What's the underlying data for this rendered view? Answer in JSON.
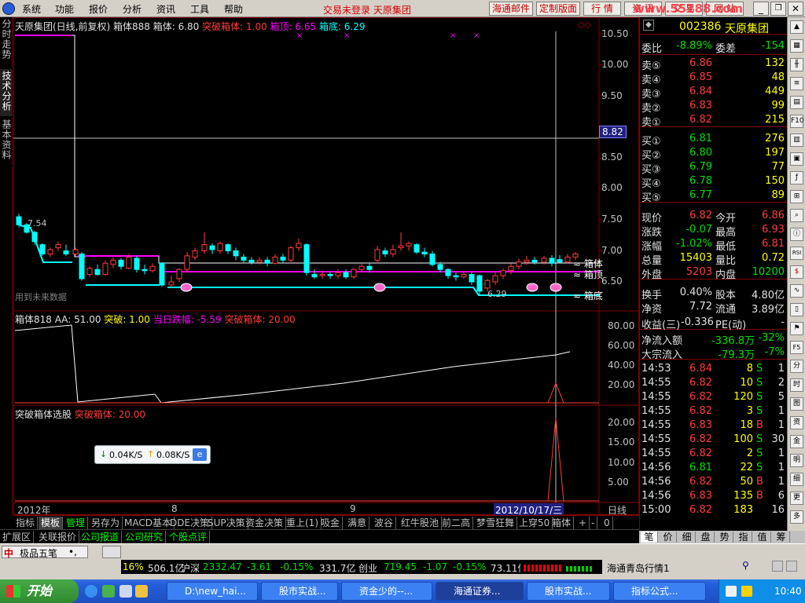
{
  "menubar": {
    "items": [
      "系统",
      "功能",
      "报价",
      "分析",
      "资讯",
      "工具",
      "帮助"
    ],
    "notice": "交易未登录  天原集团",
    "buttons": [
      "海通邮件",
      "定制版面",
      "行 情",
      "资 讯",
      "交 易",
      "网 站"
    ],
    "watermark": "www.55188.com"
  },
  "left_tabs": [
    "分时走势",
    "技术分析",
    "基本资料"
  ],
  "main_chart": {
    "title_left": "天原集团(日线,前复权) 箱体888",
    "box": "箱体: 6.80",
    "breakout": "突破箱体: 1.00",
    "top": "箱顶: 6.65",
    "bottom": "箱底: 6.29",
    "y_ticks": [
      "10.50",
      "10.00",
      "9.50",
      "8.82",
      "8.50",
      "8.00",
      "7.50",
      "7.00",
      "6.50"
    ],
    "hi_label": "7.54",
    "lo_label": "6.29",
    "future_note": "用到未来数据",
    "right_labels": [
      "箱体",
      "箱顶",
      "箱底"
    ],
    "cursor_price": "8.82"
  },
  "sub1": {
    "title": "箱体818",
    "aa": "AA: 51.00",
    "tupo": "突破: 1.00",
    "drop": "当日跌幅: -5.59",
    "breakout": "突破箱体: 20.00",
    "y_ticks": [
      "80.00",
      "60.00",
      "40.00",
      "20.00"
    ]
  },
  "sub2": {
    "title": "突破箱体选股",
    "breakout": "突破箱体: 20.00",
    "y_ticks": [
      "20.00",
      "15.00",
      "10.00",
      "5.00"
    ]
  },
  "x_axis": {
    "year": "2012年",
    "m8": "8",
    "m9": "9",
    "cursor_date": "2012/10/17/三",
    "period": "日线"
  },
  "netwidget": {
    "down": "0.04K/S",
    "up": "0.08K/S"
  },
  "quote": {
    "code": "002386",
    "name": "天原集团",
    "weibi_label": "委比",
    "weibi": "-8.89%",
    "weicha_label": "委差",
    "weicha": "-154",
    "asks": [
      {
        "label": "卖⑤",
        "price": "6.86",
        "vol": "132"
      },
      {
        "label": "卖④",
        "price": "6.85",
        "vol": "48"
      },
      {
        "label": "卖③",
        "price": "6.84",
        "vol": "449"
      },
      {
        "label": "卖②",
        "price": "6.83",
        "vol": "99"
      },
      {
        "label": "卖①",
        "price": "6.82",
        "vol": "215"
      }
    ],
    "bids": [
      {
        "label": "买①",
        "price": "6.81",
        "vol": "276"
      },
      {
        "label": "买②",
        "price": "6.80",
        "vol": "197"
      },
      {
        "label": "买③",
        "price": "6.79",
        "vol": "77"
      },
      {
        "label": "买④",
        "price": "6.78",
        "vol": "150"
      },
      {
        "label": "买⑤",
        "price": "6.77",
        "vol": "89"
      }
    ],
    "stats": [
      {
        "l1": "现价",
        "v1": "6.82",
        "c1": "red",
        "l2": "今开",
        "v2": "6.86",
        "c2": "red"
      },
      {
        "l1": "涨跌",
        "v1": "-0.07",
        "c1": "grn",
        "l2": "最高",
        "v2": "6.93",
        "c2": "red"
      },
      {
        "l1": "涨幅",
        "v1": "-1.02%",
        "c1": "grn",
        "l2": "最低",
        "v2": "6.81",
        "c2": "red"
      },
      {
        "l1": "总量",
        "v1": "15403",
        "c1": "yel",
        "l2": "量比",
        "v2": "0.72",
        "c2": "yel"
      },
      {
        "l1": "外盘",
        "v1": "5203",
        "c1": "red",
        "l2": "内盘",
        "v2": "10200",
        "c2": "grn"
      }
    ],
    "stats2": [
      {
        "l1": "换手",
        "v1": "0.40%",
        "l2": "股本",
        "v2": "4.80亿"
      },
      {
        "l1": "净资",
        "v1": "7.72",
        "l2": "流通",
        "v2": "3.89亿"
      }
    ],
    "pe": {
      "l1": "收益(三)",
      "v1": "-0.336",
      "l2": "PE(动)",
      "v2": "-"
    },
    "flow": [
      {
        "label": "净流入额",
        "value": "-336.8万",
        "pct": "-32%"
      },
      {
        "label": "大宗流入",
        "value": "-79.3万",
        "pct": "-7%"
      }
    ],
    "ticks": [
      {
        "t": "14:53",
        "p": "6.84",
        "v": "8",
        "s": "S",
        "n": "1",
        "pc": "red",
        "sc": "grn"
      },
      {
        "t": "14:55",
        "p": "6.82",
        "v": "10",
        "s": "S",
        "n": "2",
        "pc": "red",
        "sc": "grn"
      },
      {
        "t": "14:55",
        "p": "6.82",
        "v": "120",
        "s": "S",
        "n": "5",
        "pc": "red",
        "sc": "grn"
      },
      {
        "t": "14:55",
        "p": "6.82",
        "v": "3",
        "s": "S",
        "n": "1",
        "pc": "red",
        "sc": "grn"
      },
      {
        "t": "14:55",
        "p": "6.83",
        "v": "18",
        "s": "B",
        "n": "1",
        "pc": "red",
        "sc": "red"
      },
      {
        "t": "14:55",
        "p": "6.82",
        "v": "100",
        "s": "S",
        "n": "30",
        "pc": "red",
        "sc": "grn"
      },
      {
        "t": "14:55",
        "p": "6.82",
        "v": "2",
        "s": "S",
        "n": "1",
        "pc": "red",
        "sc": "grn"
      },
      {
        "t": "14:56",
        "p": "6.81",
        "v": "22",
        "s": "S",
        "n": "1",
        "pc": "grn",
        "sc": "grn"
      },
      {
        "t": "14:56",
        "p": "6.82",
        "v": "50",
        "s": "B",
        "n": "1",
        "pc": "red",
        "sc": "red"
      },
      {
        "t": "14:56",
        "p": "6.83",
        "v": "135",
        "s": "B",
        "n": "6",
        "pc": "red",
        "sc": "red"
      },
      {
        "t": "15:00",
        "p": "6.82",
        "v": "183",
        "s": "",
        "n": "16",
        "pc": "red",
        "sc": "red"
      }
    ]
  },
  "right_tools": [
    "F10",
    "RSI",
    "$",
    "F5"
  ],
  "bottom_tabs": [
    "指标",
    "模板",
    "管理",
    "另存为",
    "MACD基本",
    "DDE决策",
    "SUP决策",
    "资金决策",
    "重上(1)",
    "吸金",
    "满意",
    "波谷",
    "红牛股池",
    "前二高",
    "梦雪狂舞",
    "上穿50",
    "箱体",
    "+",
    "-",
    "0"
  ],
  "bottom_tabs2": [
    "扩展区",
    "关联报价",
    "公司报道",
    "公司研究",
    "个股点评"
  ],
  "right_bottom_tabs": [
    "笔",
    "价",
    "细",
    "盘",
    "势",
    "指",
    "值",
    "筹"
  ],
  "status": {
    "ime": "极品五笔",
    "seg1": "16%",
    "seg2": "506.1亿",
    "hs_label": "沪深",
    "hs_val": "2332.47",
    "hs_chg": "-3.61",
    "hs_pct": "-0.15%",
    "hs_amt": "331.7亿",
    "cy_label": "创业",
    "cy_val": "719.45",
    "cy_chg": "-1.07",
    "cy_pct": "-0.15%",
    "cy_amt": "73.11亿",
    "server": "海通青岛行情1"
  },
  "taskbar": {
    "start": "开始",
    "tasks": [
      "D:\\new_hai...",
      "股市实战...",
      "资金少的--...",
      "海通证券...",
      "股市实战...",
      "指标公式..."
    ],
    "clock": "10:40"
  },
  "colors": {
    "bg": "#000000",
    "up": "#ff3b3b",
    "down": "#00ffff",
    "box_top": "#ff00ff",
    "box_bottom": "#00ffff",
    "grid": "#800000"
  }
}
